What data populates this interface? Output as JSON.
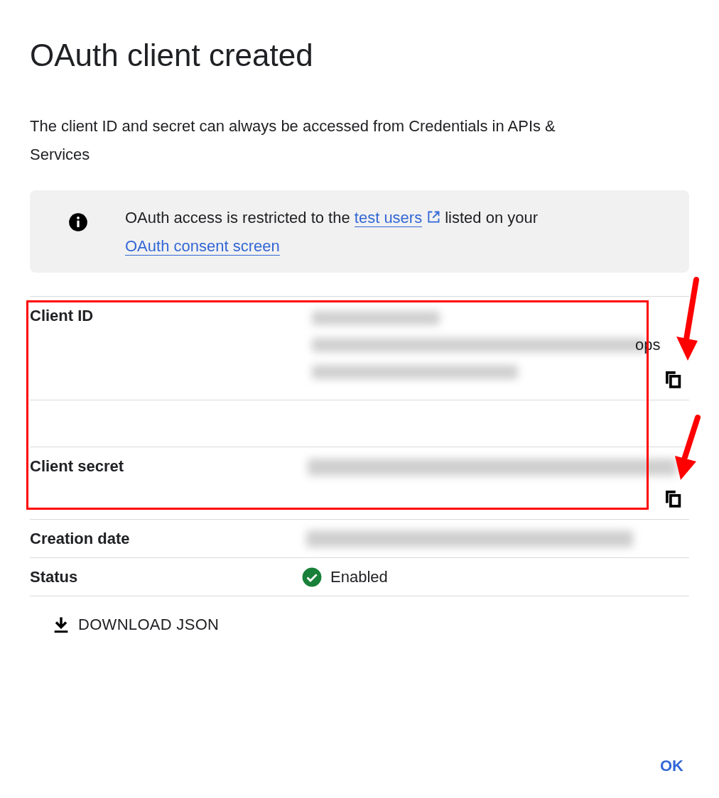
{
  "dialog": {
    "title": "OAuth client created",
    "description": "The client ID and secret can always be accessed from Credentials in APIs & Services"
  },
  "notice": {
    "text_before": "OAuth access is restricted to the",
    "link_1": "test users",
    "text_after": "listed on your",
    "link_2": "OAuth consent screen"
  },
  "rows": [
    {
      "kind": "client_id",
      "label": "Client ID",
      "value_tail": "ops",
      "copyable": true
    },
    {
      "kind": "blank"
    },
    {
      "kind": "client_secret",
      "label": "Client secret",
      "copyable": true
    },
    {
      "kind": "date",
      "label": "Creation date"
    },
    {
      "kind": "status",
      "label": "Status",
      "value": "Enabled",
      "enabled": true
    }
  ],
  "download_button": "DOWNLOAD JSON",
  "ok_button": "OK",
  "annotations": [
    {
      "kind": "box"
    },
    {
      "kind": "arrow"
    },
    {
      "kind": "arrow"
    }
  ]
}
